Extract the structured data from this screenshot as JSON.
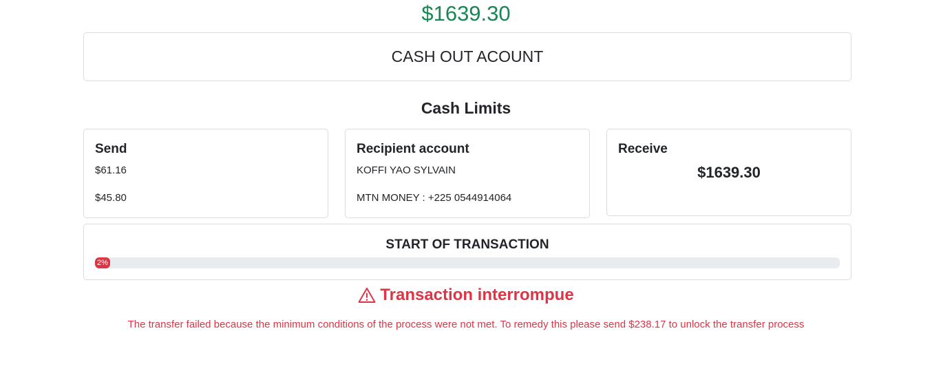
{
  "balance": "$1639.30",
  "cashout": {
    "title": "CASH OUT ACOUNT"
  },
  "limits": {
    "title": "Cash Limits"
  },
  "send": {
    "title": "Send",
    "amount1": "$61.16",
    "amount2": "$45.80"
  },
  "recipient": {
    "title": "Recipient account",
    "name": "KOFFI YAO SYLVAIN",
    "account": "MTN MONEY : +225 0544914064"
  },
  "receive": {
    "title": "Receive",
    "amount": "$1639.30"
  },
  "transaction": {
    "title": "START OF TRANSACTION",
    "progress_label": "2%",
    "progress_value": 2
  },
  "error": {
    "icon": "warning-triangle-icon",
    "title": "Transaction interrompue",
    "message": "The transfer failed because the minimum conditions of the process were not met. To remedy this please send $238.17 to unlock the transfer process"
  },
  "colors": {
    "success": "#198754",
    "danger": "#dc3545",
    "track": "#e9ecef"
  }
}
